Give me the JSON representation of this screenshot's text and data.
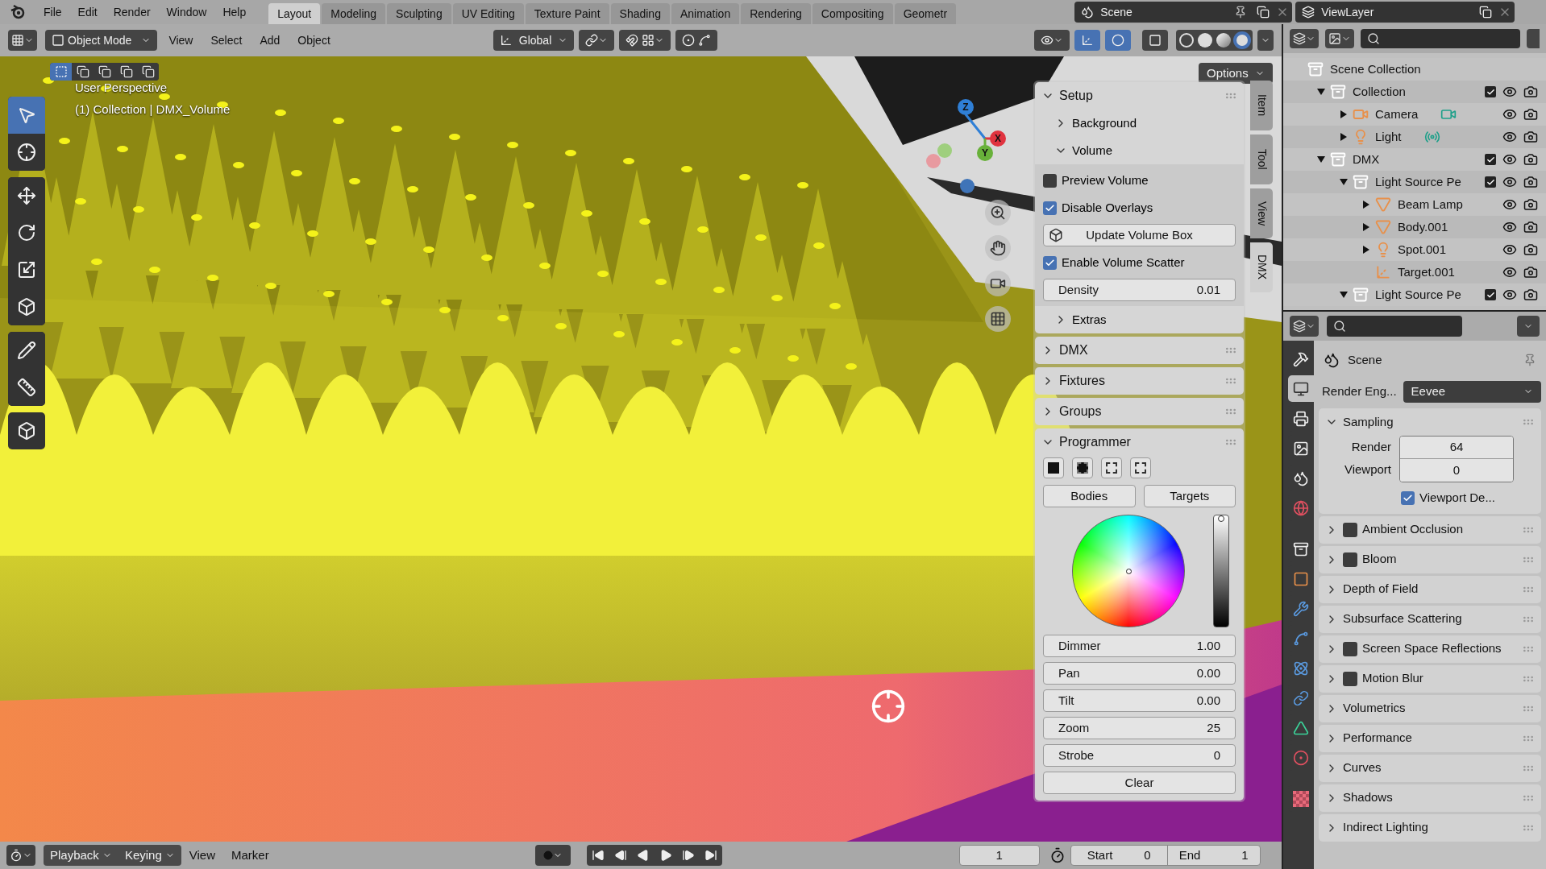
{
  "top_bar": {
    "menus": [
      "File",
      "Edit",
      "Render",
      "Window",
      "Help"
    ],
    "workspaces": [
      {
        "label": "Layout",
        "selected": true
      },
      {
        "label": "Modeling",
        "selected": false
      },
      {
        "label": "Sculpting",
        "selected": false
      },
      {
        "label": "UV Editing",
        "selected": false
      },
      {
        "label": "Texture Paint",
        "selected": false
      },
      {
        "label": "Shading",
        "selected": false
      },
      {
        "label": "Animation",
        "selected": false
      },
      {
        "label": "Rendering",
        "selected": false
      },
      {
        "label": "Compositing",
        "selected": false
      },
      {
        "label": "Geometr",
        "selected": false
      }
    ],
    "scene": "Scene",
    "view_layer": "ViewLayer"
  },
  "viewport_header": {
    "mode": "Object Mode",
    "menus": [
      "View",
      "Select",
      "Add",
      "Object"
    ],
    "orientation": "Global",
    "shading": [
      {
        "kind": "wireframe",
        "selected": false
      },
      {
        "kind": "solid",
        "selected": false
      },
      {
        "kind": "material",
        "selected": false
      },
      {
        "kind": "rendered",
        "selected": true
      }
    ]
  },
  "select_modes": [
    {
      "kind": "new",
      "selected": true
    },
    {
      "kind": "extend",
      "selected": false
    },
    {
      "kind": "subtract",
      "selected": false
    },
    {
      "kind": "difference",
      "selected": false
    },
    {
      "kind": "intersect",
      "selected": false
    }
  ],
  "toolbar": [
    [
      {
        "kind": "select",
        "selected": true
      },
      {
        "kind": "cursor",
        "selected": false
      }
    ],
    [
      {
        "kind": "move",
        "selected": false
      },
      {
        "kind": "rotate",
        "selected": false
      },
      {
        "kind": "scale",
        "selected": false
      },
      {
        "kind": "transform",
        "selected": false
      }
    ],
    [
      {
        "kind": "annotate",
        "selected": false
      },
      {
        "kind": "measure",
        "selected": false
      }
    ],
    [
      {
        "kind": "add_cube",
        "selected": false
      }
    ]
  ],
  "viewport": {
    "info": [
      "User Perspective",
      "(1) Collection | DMX_Volume"
    ],
    "options": "Options",
    "gizmo": [
      "Z",
      "X",
      "Y"
    ]
  },
  "sidebar": {
    "tabs": [
      {
        "label": "Item",
        "selected": false
      },
      {
        "label": "Tool",
        "selected": false
      },
      {
        "label": "View",
        "selected": false
      },
      {
        "label": "DMX",
        "selected": true
      }
    ],
    "panels": [
      {
        "title": "Setup",
        "expanded": true,
        "children": [
          {
            "kind": "subpanel",
            "title": "Background",
            "expanded": false
          },
          {
            "kind": "subpanel",
            "title": "Volume",
            "expanded": true,
            "children": [
              {
                "kind": "checkbox",
                "label": "Preview Volume",
                "checked": false
              },
              {
                "kind": "checkbox",
                "label": "Disable Overlays",
                "checked": true
              },
              {
                "kind": "icon_button",
                "label": "Update Volume Box"
              },
              {
                "kind": "checkbox",
                "label": "Enable Volume Scatter",
                "checked": true
              },
              {
                "kind": "number",
                "label": "Density",
                "value": "0.01"
              }
            ]
          },
          {
            "kind": "subpanel",
            "title": "Extras",
            "expanded": false
          }
        ]
      },
      {
        "title": "DMX",
        "expanded": false
      },
      {
        "title": "Fixtures",
        "expanded": false
      },
      {
        "title": "Groups",
        "expanded": false
      },
      {
        "title": "Programmer",
        "expanded": true,
        "children": [
          {
            "kind": "select_icons"
          },
          {
            "kind": "pair",
            "labels": [
              "Bodies",
              "Targets"
            ]
          },
          {
            "kind": "color",
            "level": 1
          },
          {
            "kind": "number",
            "label": "Dimmer",
            "value": "1.00"
          },
          {
            "kind": "number",
            "label": "Pan",
            "value": "0.00"
          },
          {
            "kind": "number",
            "label": "Tilt",
            "value": "0.00"
          },
          {
            "kind": "number",
            "label": "Zoom",
            "value": "25"
          },
          {
            "kind": "number",
            "label": "Strobe",
            "value": "0"
          },
          {
            "kind": "button",
            "label": "Clear"
          }
        ]
      }
    ]
  },
  "outliner": {
    "items": [
      {
        "name": "Scene Collection",
        "kind": "scene_collection",
        "children": [
          {
            "name": "Collection",
            "kind": "collection",
            "expanded": true,
            "checked": true,
            "children": [
              {
                "name": "Camera",
                "kind": "camera",
                "expanded": false,
                "data_icon": true
              },
              {
                "name": "Light",
                "kind": "light",
                "expanded": false,
                "data_icon": true
              }
            ]
          },
          {
            "name": "DMX",
            "kind": "collection",
            "expanded": true,
            "checked": true,
            "children": [
              {
                "name": "Light Source Pe",
                "kind": "collection",
                "expanded": true,
                "checked": true,
                "children": [
                  {
                    "name": "Beam Lamp",
                    "kind": "mesh",
                    "expanded": false
                  },
                  {
                    "name": "Body.001",
                    "kind": "mesh",
                    "expanded": false
                  },
                  {
                    "name": "Spot.001",
                    "kind": "light",
                    "expanded": false,
                    "data_icon": false
                  },
                  {
                    "name": "Target.001",
                    "kind": "empty"
                  }
                ]
              },
              {
                "name": "Light Source Pe",
                "kind": "collection",
                "expanded": true,
                "checked": true
              }
            ]
          }
        ]
      }
    ]
  },
  "properties": {
    "tabs": [
      {
        "kind": "tool",
        "selected": false
      },
      {
        "kind": "render",
        "selected": true
      },
      {
        "kind": "output",
        "selected": false
      },
      {
        "kind": "view_layer",
        "selected": false
      },
      {
        "kind": "scene",
        "selected": false
      },
      {
        "kind": "world",
        "selected": false
      },
      {
        "kind": "collection",
        "selected": false
      },
      {
        "kind": "object",
        "selected": false
      },
      {
        "kind": "modifier",
        "selected": false
      },
      {
        "kind": "particles",
        "selected": false
      },
      {
        "kind": "physics",
        "selected": false
      },
      {
        "kind": "constraints",
        "selected": false
      },
      {
        "kind": "data",
        "selected": false
      },
      {
        "kind": "material",
        "selected": false
      },
      {
        "kind": "texture",
        "selected": false
      }
    ],
    "context": "Scene",
    "engine_label": "Render Eng...",
    "engine": "Eevee",
    "sections": [
      {
        "title": "Sampling",
        "expanded": true,
        "fields": [
          {
            "label": "Render",
            "value": "64"
          },
          {
            "label": "Viewport",
            "value": "0"
          }
        ],
        "option": {
          "label": "Viewport De...",
          "checked": true
        }
      },
      {
        "title": "Ambient Occlusion",
        "expanded": false,
        "checked": false
      },
      {
        "title": "Bloom",
        "expanded": false,
        "checked": false
      },
      {
        "title": "Depth of Field",
        "expanded": false
      },
      {
        "title": "Subsurface Scattering",
        "expanded": false
      },
      {
        "title": "Screen Space Reflections",
        "expanded": false,
        "checked": false
      },
      {
        "title": "Motion Blur",
        "expanded": false,
        "checked": false
      },
      {
        "title": "Volumetrics",
        "expanded": false
      },
      {
        "title": "Performance",
        "expanded": false
      },
      {
        "title": "Curves",
        "expanded": false
      },
      {
        "title": "Shadows",
        "expanded": false
      },
      {
        "title": "Indirect Lighting",
        "expanded": false
      }
    ]
  },
  "timeline": {
    "menus": [
      {
        "label": "Playback",
        "dropdown": true
      },
      {
        "label": "Keying",
        "dropdown": true
      },
      {
        "label": "View",
        "dropdown": false
      },
      {
        "label": "Marker",
        "dropdown": false
      }
    ],
    "frame": "1",
    "start_label": "Start",
    "start": "0",
    "end_label": "End",
    "end": "1"
  }
}
